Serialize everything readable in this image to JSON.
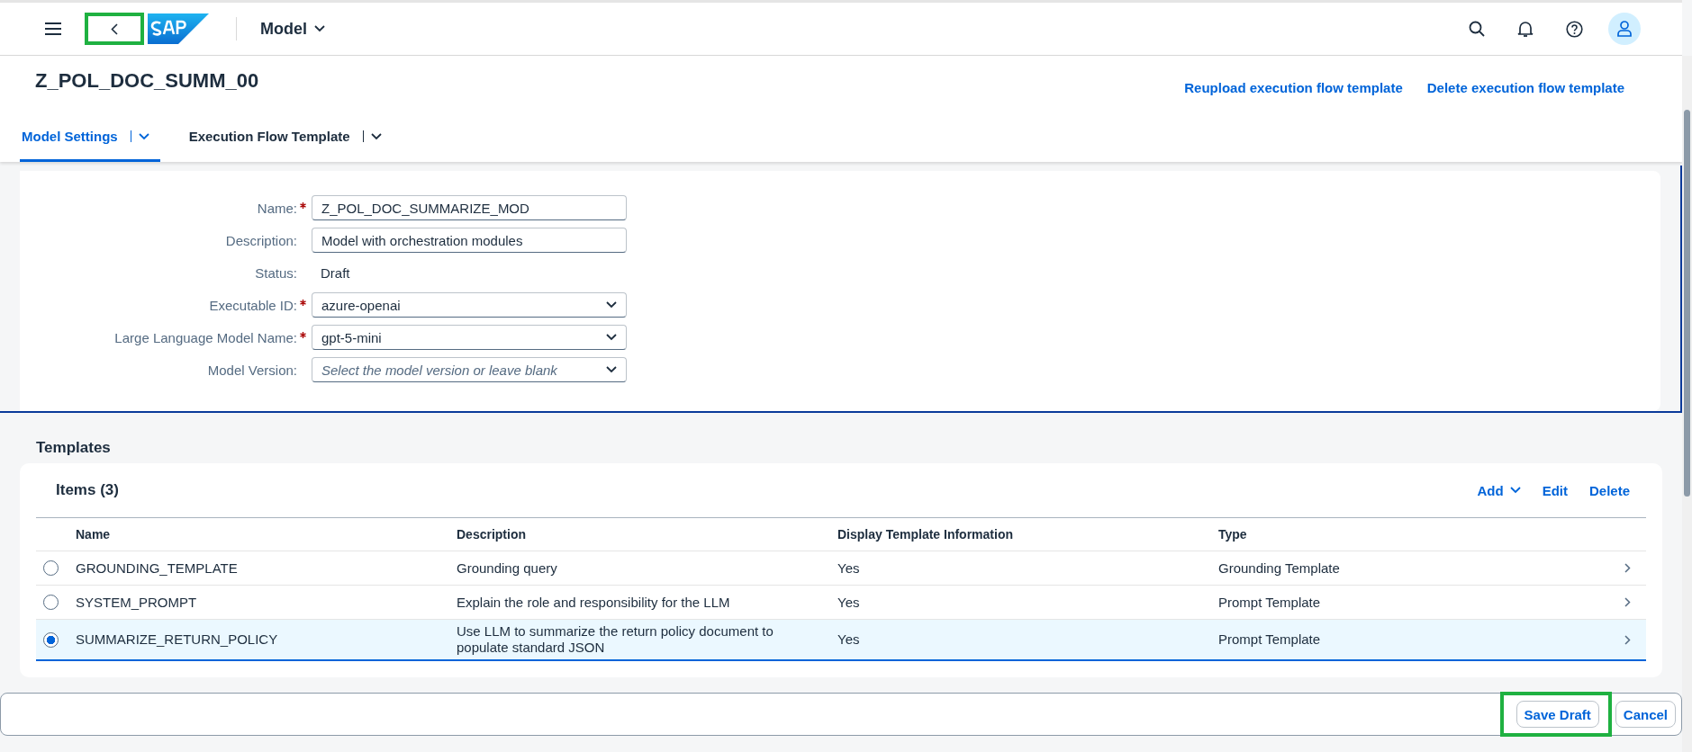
{
  "shell": {
    "app_title": "Model",
    "back_highlighted": true
  },
  "header": {
    "title": "Z_POL_DOC_SUMM_00",
    "actions": [
      "Reupload execution flow template",
      "Delete execution flow template"
    ]
  },
  "tabs": [
    {
      "label": "Model Settings",
      "selected": true
    },
    {
      "label": "Execution Flow Template",
      "selected": false
    }
  ],
  "form": {
    "fields": [
      {
        "label": "Name:",
        "required": true,
        "kind": "input",
        "value": "Z_POL_DOC_SUMMARIZE_MOD"
      },
      {
        "label": "Description:",
        "required": false,
        "kind": "input",
        "value": "Model with orchestration modules"
      },
      {
        "label": "Status:",
        "required": false,
        "kind": "text",
        "value": "Draft"
      },
      {
        "label": "Executable ID:",
        "required": true,
        "kind": "select",
        "value": "azure-openai"
      },
      {
        "label": "Large Language Model Name:",
        "required": true,
        "kind": "select",
        "value": "gpt-5-mini"
      },
      {
        "label": "Model Version:",
        "required": false,
        "kind": "select",
        "placeholder": "Select the model version or leave blank"
      }
    ]
  },
  "templates": {
    "heading": "Templates",
    "table_title": "Items (3)",
    "actions": [
      "Add",
      "Edit",
      "Delete"
    ],
    "columns": [
      "Name",
      "Description",
      "Display Template Information",
      "Type"
    ],
    "rows": [
      {
        "selected": false,
        "cells": [
          "GROUNDING_TEMPLATE",
          "Grounding query",
          "Yes",
          "Grounding Template"
        ]
      },
      {
        "selected": false,
        "cells": [
          "SYSTEM_PROMPT",
          "Explain the role and responsibility for the LLM",
          "Yes",
          "Prompt Template"
        ]
      },
      {
        "selected": true,
        "cells": [
          "SUMMARIZE_RETURN_POLICY",
          "Use LLM to summarize the return policy document to populate standard JSON",
          "Yes",
          "Prompt Template"
        ]
      }
    ]
  },
  "footer": {
    "buttons": [
      {
        "label": "Save Draft",
        "highlighted": true
      },
      {
        "label": "Cancel",
        "highlighted": false
      }
    ]
  }
}
